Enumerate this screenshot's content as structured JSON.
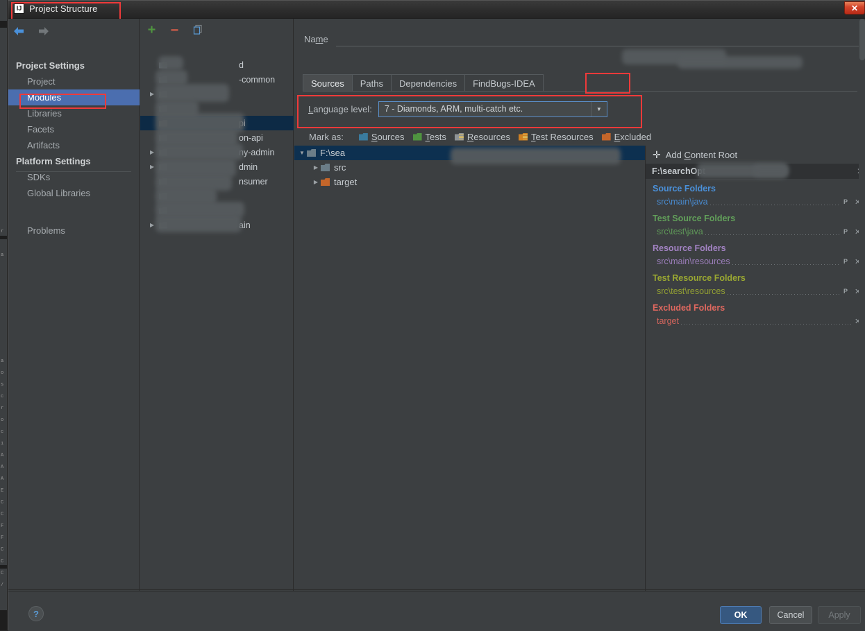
{
  "window": {
    "title": "Project Structure",
    "app_icon": "IJ",
    "close_label": "✕",
    "accent_annotation_color": "#ef3a3a",
    "selection_color": "#4b6eaf"
  },
  "nav": {
    "back_icon": "arrow-left-icon",
    "forward_icon": "arrow-right-icon"
  },
  "sidebar": {
    "items": [
      {
        "label": "Project Settings",
        "type": "group"
      },
      {
        "label": "Project",
        "type": "child"
      },
      {
        "label": "Modules",
        "type": "child",
        "selected": true
      },
      {
        "label": "Libraries",
        "type": "child"
      },
      {
        "label": "Facets",
        "type": "child"
      },
      {
        "label": "Artifacts",
        "type": "child"
      },
      {
        "label": "Platform Settings",
        "type": "group"
      },
      {
        "label": "SDKs",
        "type": "child"
      },
      {
        "label": "Global Libraries",
        "type": "child"
      },
      {
        "label": "",
        "type": "spacer"
      },
      {
        "label": "Problems",
        "type": "child"
      }
    ]
  },
  "module_tree": {
    "toolbar": [
      {
        "name": "add-module-button",
        "glyph": "+",
        "color": "#4f9440"
      },
      {
        "name": "remove-module-button",
        "glyph": "−",
        "color": "#d45d4a"
      },
      {
        "name": "copy-module-button",
        "glyph": "copy-icon",
        "color": "#5b9bd5"
      }
    ],
    "rows": [
      {
        "label": "d",
        "expandable": false,
        "redacted": true
      },
      {
        "label": "-common",
        "expandable": false,
        "redacted": true
      },
      {
        "label": "",
        "expandable": true,
        "redacted": true
      },
      {
        "label": "",
        "expandable": false,
        "redacted": true
      },
      {
        "label": "pi",
        "expandable": false,
        "redacted": true,
        "selected": true
      },
      {
        "label": "on-api",
        "expandable": false,
        "redacted": true
      },
      {
        "label": "ny-admin",
        "expandable": true,
        "redacted": true
      },
      {
        "label": "dmin",
        "expandable": true,
        "redacted": true
      },
      {
        "label": "nsumer",
        "expandable": false,
        "redacted": true
      },
      {
        "label": "",
        "expandable": false,
        "redacted": true
      },
      {
        "label": "",
        "expandable": false,
        "redacted": true
      },
      {
        "label": "ain",
        "expandable": true,
        "redacted": true
      }
    ]
  },
  "main": {
    "name_label": "Name",
    "name_value": "",
    "tabs": [
      {
        "label": "Sources",
        "active": true
      },
      {
        "label": "Paths",
        "active": false
      },
      {
        "label": "Dependencies",
        "active": false
      },
      {
        "label": "FindBugs-IDEA",
        "active": false
      }
    ],
    "language_level": {
      "label": "Language level:",
      "value": "7 - Diamonds, ARM, multi-catch etc.",
      "dropdown_icon": "chevron-down-icon"
    },
    "mark_as": {
      "label": "Mark as:",
      "options": [
        {
          "label": "Sources",
          "mnemonic": "S",
          "color": "#3a7b9e",
          "icon": "folder-blue-icon"
        },
        {
          "label": "Tests",
          "mnemonic": "T",
          "color": "#4f9440",
          "icon": "folder-green-icon"
        },
        {
          "label": "Resources",
          "mnemonic": "R",
          "color": "#8e9396",
          "icon": "folder-resources-icon"
        },
        {
          "label": "Test Resources",
          "mnemonic": "T",
          "color": "#d08022",
          "icon": "folder-test-resources-icon"
        },
        {
          "label": "Excluded",
          "mnemonic": "E",
          "color": "#c4662a",
          "icon": "folder-excluded-icon"
        }
      ]
    },
    "folder_tree": [
      {
        "label": "F:\\sea",
        "depth": 0,
        "expanded": true,
        "folder": "blue",
        "selected": true,
        "redacted": true
      },
      {
        "label": "src",
        "depth": 1,
        "expanded": false,
        "folder": "blue",
        "selected": false
      },
      {
        "label": "target",
        "depth": 1,
        "expanded": false,
        "folder": "orange",
        "selected": false
      }
    ]
  },
  "content_root": {
    "add_label": "Add Content Root",
    "add_icon": "plus-icon",
    "root_path": "F:\\searchOpt",
    "remove_icon": "close-icon",
    "groups": [
      {
        "title": "Source Folders",
        "color": "#4a90d9",
        "items": [
          {
            "path": "src\\main\\java",
            "props_icon": "properties-icon",
            "remove_icon": "close-icon"
          }
        ]
      },
      {
        "title": "Test Source Folders",
        "color": "#62a05a",
        "items": [
          {
            "path": "src\\test\\java",
            "props_icon": "properties-icon",
            "remove_icon": "close-icon"
          }
        ]
      },
      {
        "title": "Resource Folders",
        "color": "#a383c4",
        "items": [
          {
            "path": "src\\main\\resources",
            "props_icon": "properties-icon",
            "remove_icon": "close-icon"
          }
        ]
      },
      {
        "title": "Test Resource Folders",
        "color": "#9aa832",
        "items": [
          {
            "path": "src\\test\\resources",
            "props_icon": "properties-icon",
            "remove_icon": "close-icon"
          }
        ]
      },
      {
        "title": "Excluded Folders",
        "color": "#e0685f",
        "items": [
          {
            "path": "target",
            "props_icon": "",
            "remove_icon": "close-icon"
          }
        ]
      }
    ]
  },
  "footer": {
    "help_label": "?",
    "ok_label": "OK",
    "cancel_label": "Cancel",
    "apply_label": "Apply"
  }
}
